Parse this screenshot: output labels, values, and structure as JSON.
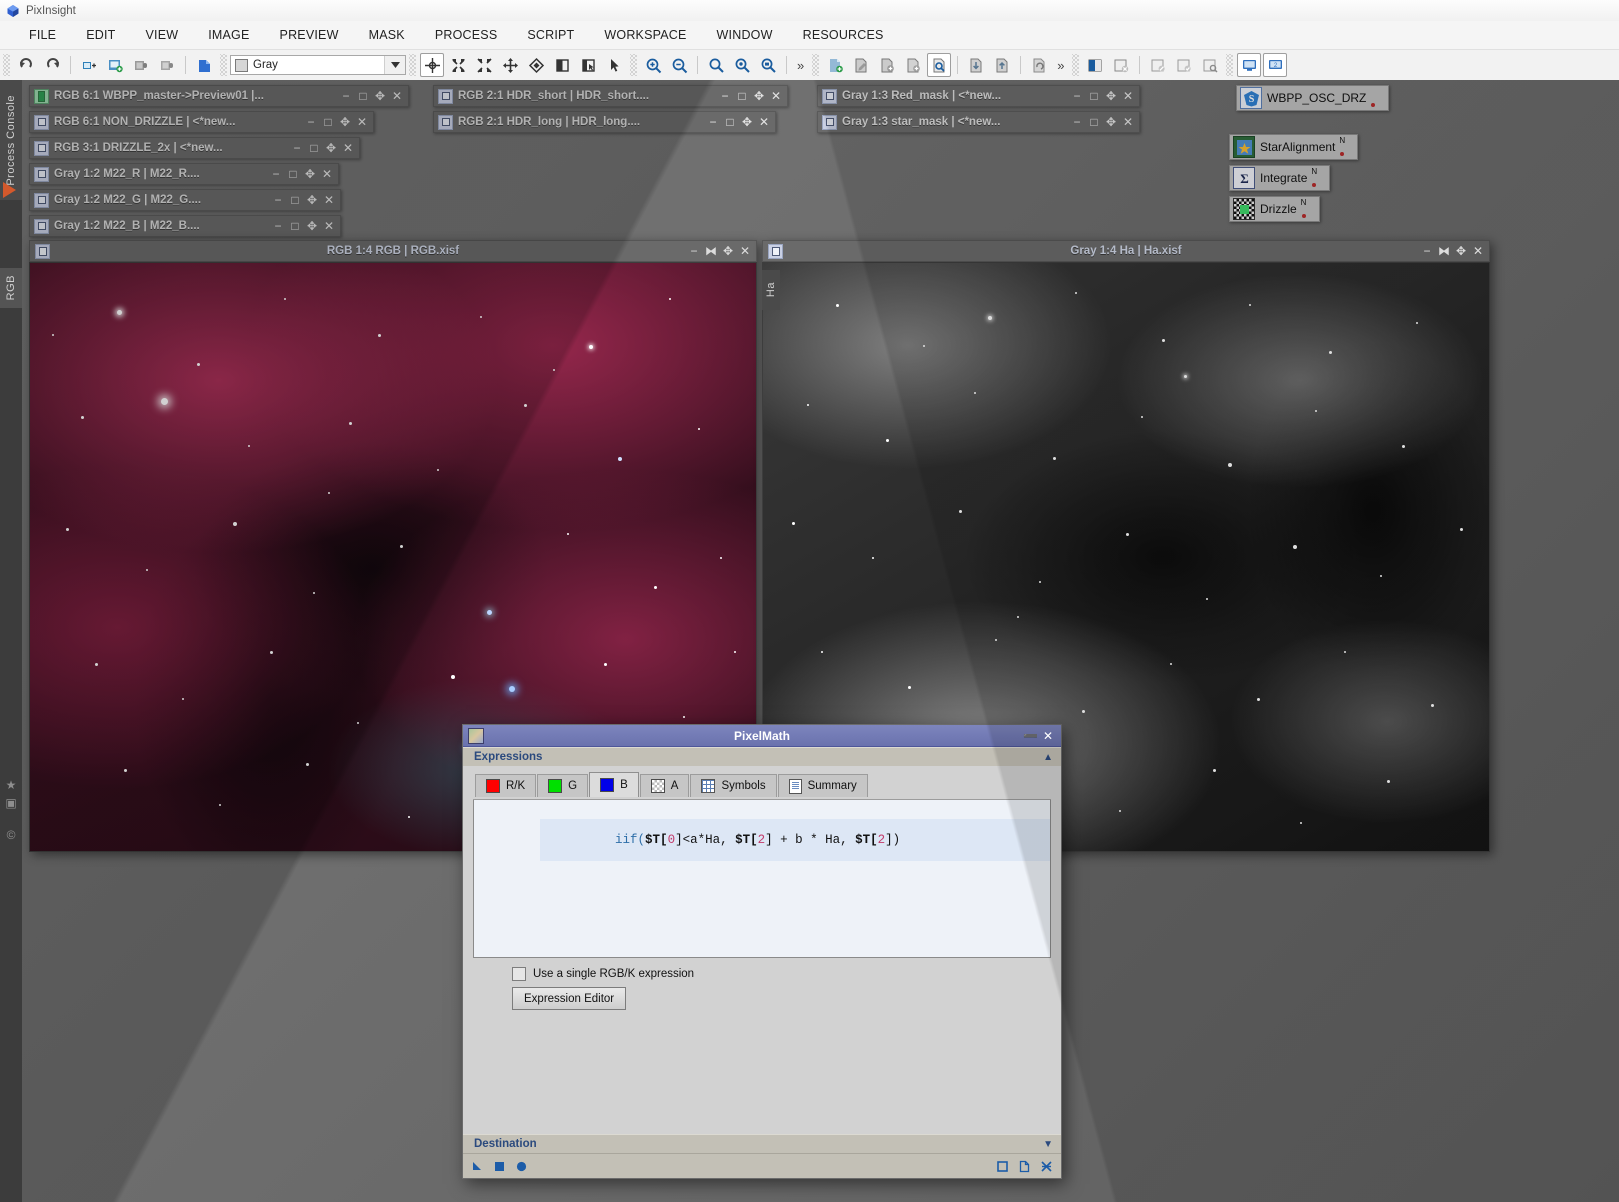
{
  "app": {
    "title": "PixInsight",
    "logo_icon": "pixinsight-logo-icon"
  },
  "menubar": {
    "items": [
      {
        "label": "FILE"
      },
      {
        "label": "EDIT"
      },
      {
        "label": "VIEW"
      },
      {
        "label": "IMAGE"
      },
      {
        "label": "PREVIEW"
      },
      {
        "label": "MASK"
      },
      {
        "label": "PROCESS"
      },
      {
        "label": "SCRIPT"
      },
      {
        "label": "WORKSPACE"
      },
      {
        "label": "WINDOW"
      },
      {
        "label": "RESOURCES"
      }
    ]
  },
  "toolbar": {
    "colorspace_value": "Gray",
    "overflow_label": "»",
    "buttons": [
      {
        "name": "undo-icon"
      },
      {
        "name": "redo-icon"
      },
      {
        "name": "new-image-icon"
      },
      {
        "name": "open-image-icon"
      },
      {
        "name": "save-image-icon"
      },
      {
        "name": "save-as-image-icon"
      },
      {
        "name": "blue-document-icon"
      },
      {
        "name": "move-crosshair-icon"
      },
      {
        "name": "fit-view-icon"
      },
      {
        "name": "zoom-fit-icon"
      },
      {
        "name": "expand-icon"
      },
      {
        "name": "diamond-icon"
      },
      {
        "name": "half-panel-icon"
      },
      {
        "name": "panel-pointer-icon"
      },
      {
        "name": "arrow-pointer-icon"
      },
      {
        "name": "zoom-in-icon"
      },
      {
        "name": "zoom-out-icon"
      },
      {
        "name": "zoom-1-1-icon"
      },
      {
        "name": "zoom-fit-window-icon"
      },
      {
        "name": "zoom-optimal-icon"
      },
      {
        "name": "new-preview-icon"
      },
      {
        "name": "edit-preview-icon"
      },
      {
        "name": "add-preview-icon"
      },
      {
        "name": "add-preview-alt-icon"
      },
      {
        "name": "preview-search-icon"
      },
      {
        "name": "import-preview-icon"
      },
      {
        "name": "export-preview-icon"
      },
      {
        "name": "undo-preview-icon"
      },
      {
        "name": "mask-show-icon"
      },
      {
        "name": "mask-remove-icon"
      },
      {
        "name": "mask-invert-icon"
      },
      {
        "name": "mask-enable-icon"
      },
      {
        "name": "mask-select-icon"
      },
      {
        "name": "screen-transfer-icon"
      },
      {
        "name": "screen-transfer-alt-icon"
      }
    ]
  },
  "left_dock": {
    "tabs": [
      {
        "label": "Process Console",
        "name": "sidebar-tab-process-console"
      },
      {
        "label": "RGB",
        "name": "sidebar-tab-rgb"
      },
      {
        "label": "Ha",
        "name": "sidebar-tab-ha"
      }
    ],
    "marker_icon": "orange-triangle-icon",
    "bottom_icons": [
      "histogram-icon",
      "camera-icon",
      "copyright-icon"
    ]
  },
  "iconised_windows": {
    "column1": [
      {
        "title": "RGB 6:1 WBPP_master->Preview01 |...",
        "icon": "preview-window-icon"
      },
      {
        "title": "RGB 6:1 NON_DRIZZLE | <*new...",
        "icon": "image-window-icon"
      },
      {
        "title": "RGB 3:1 DRIZZLE_2x | <*new...",
        "icon": "image-window-icon"
      },
      {
        "title": "Gray 1:2 M22_R | M22_R....",
        "icon": "image-window-icon"
      },
      {
        "title": "Gray 1:2 M22_G | M22_G....",
        "icon": "image-window-icon"
      },
      {
        "title": "Gray 1:2 M22_B | M22_B....",
        "icon": "image-window-icon"
      }
    ],
    "column2": [
      {
        "title": "RGB 2:1 HDR_short | HDR_short....",
        "icon": "image-window-icon"
      },
      {
        "title": "RGB 2:1 HDR_long | HDR_long....",
        "icon": "image-window-icon"
      }
    ],
    "column3": [
      {
        "title": "Gray 1:3 Red_mask | <*new...",
        "icon": "image-window-icon"
      },
      {
        "title": "Gray 1:3 star_mask | <*new...",
        "icon": "image-window-icon"
      }
    ],
    "window_buttons": [
      "−",
      "□",
      "✥",
      "✕"
    ]
  },
  "process_icons": [
    {
      "label": "WBPP_OSC_DRZ",
      "icon": "script-superbias-icon",
      "badge": ""
    },
    {
      "label": "StarAlignment",
      "icon": "staralignment-icon",
      "badge": "N"
    },
    {
      "label": "Integrate",
      "icon": "imageintegration-sigma-icon",
      "badge": "N"
    },
    {
      "label": "Drizzle",
      "icon": "drizzleintegration-icon",
      "badge": "N"
    }
  ],
  "image_windows": [
    {
      "name": "rgb-image-window",
      "title": "RGB 1:4 RGB | RGB.xisf",
      "buttons": [
        "−",
        "⧓",
        "✥",
        "✕"
      ]
    },
    {
      "name": "ha-image-window",
      "title": "Gray 1:4 Ha | Ha.xisf",
      "buttons": [
        "−",
        "⧓",
        "✥",
        "✕"
      ]
    }
  ],
  "pixelmath": {
    "title": "PixelMath",
    "icon": "pixelmath-icon",
    "title_buttons": [
      "✕"
    ],
    "collapse_button": "➖",
    "sections": {
      "expressions": "Expressions",
      "destination": "Destination"
    },
    "tabs": [
      {
        "label": "R/K",
        "swatch": "r",
        "selected": false,
        "name": "tab-rk"
      },
      {
        "label": "G",
        "swatch": "g",
        "selected": false,
        "name": "tab-g"
      },
      {
        "label": "B",
        "swatch": "b",
        "selected": true,
        "name": "tab-b"
      },
      {
        "label": "A",
        "swatch": "a",
        "selected": false,
        "name": "tab-a"
      },
      {
        "label": "Symbols",
        "swatch": "grid",
        "selected": false,
        "name": "tab-symbols"
      },
      {
        "label": "Summary",
        "swatch": "doc",
        "selected": false,
        "name": "tab-summary"
      }
    ],
    "expression": {
      "full_text": "iif($T[0]<a*Ha, $T[2] + b * Ha, $T[2])",
      "tokens": [
        {
          "t": "iif(",
          "c": "f"
        },
        {
          "t": "$T[",
          "c": "v"
        },
        {
          "t": "0",
          "c": "n"
        },
        {
          "t": "]<a*Ha, ",
          "c": "p"
        },
        {
          "t": "$T[",
          "c": "v"
        },
        {
          "t": "2",
          "c": "n"
        },
        {
          "t": "] + b * Ha, ",
          "c": "p"
        },
        {
          "t": "$T[",
          "c": "v"
        },
        {
          "t": "2",
          "c": "n"
        },
        {
          "t": "])",
          "c": "p"
        }
      ]
    },
    "single_expression_checkbox": {
      "label": "Use a single RGB/K expression",
      "checked": false
    },
    "expression_editor_button": "Expression Editor",
    "footer_icons": [
      {
        "name": "apply-arrow-icon",
        "shape": "triangle"
      },
      {
        "name": "apply-global-icon",
        "shape": "square"
      },
      {
        "name": "execute-icon",
        "shape": "circle"
      },
      {
        "name": "new-instance-icon",
        "shape": "outline-square"
      },
      {
        "name": "browse-documentation-icon",
        "shape": "doc"
      },
      {
        "name": "reset-icon",
        "shape": "reset"
      }
    ]
  },
  "colors": {
    "accent": "#2b4a7e",
    "dialog_title": "#6a72ae",
    "desktop": "#6e6e6e",
    "toolbar_bg": "#f2f2f2",
    "window_bar": "#6a6a6a"
  }
}
